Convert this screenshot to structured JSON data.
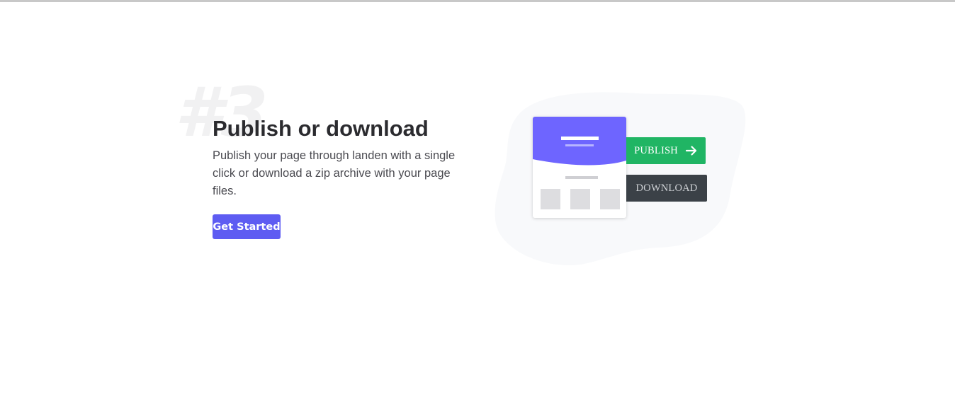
{
  "feature": {
    "step_number": "#3",
    "title": "Publish or download",
    "description": "Publish your page through landen with a single click or download a zip archive with your page files.",
    "cta_label": "Get Started"
  },
  "illustration": {
    "publish_label": "PUBLISH",
    "download_label": "DOWNLOAD",
    "icons": {
      "publish_arrow": "arrow-right-icon"
    }
  },
  "colors": {
    "primary": "#5e5cf2",
    "card_header": "#6e65ff",
    "publish": "#20b564",
    "download": "#3b4147",
    "heading": "#2b2b2f",
    "body_text": "#4a4a50",
    "blob": "#f8f9fb"
  }
}
